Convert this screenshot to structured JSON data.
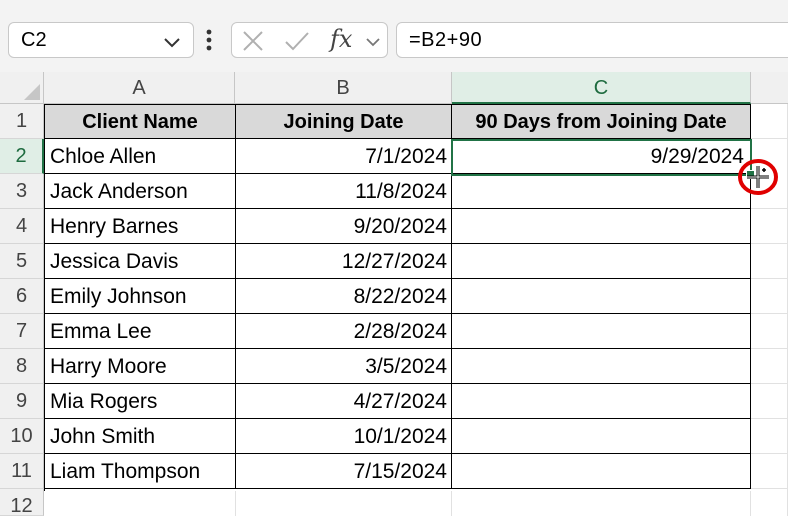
{
  "formula_bar": {
    "name_box": "C2",
    "fx_label": "fx",
    "formula": "=B2+90"
  },
  "columns": [
    "A",
    "B",
    "C"
  ],
  "rows": [
    "1",
    "2",
    "3",
    "4",
    "5",
    "6",
    "7",
    "8",
    "9",
    "10",
    "11",
    "12"
  ],
  "table": {
    "headers": [
      "Client Name",
      "Joining Date",
      "90 Days from Joining Date"
    ],
    "rows": [
      {
        "name": "Chloe Allen",
        "date": "7/1/2024",
        "result": "9/29/2024"
      },
      {
        "name": "Jack Anderson",
        "date": "11/8/2024",
        "result": ""
      },
      {
        "name": "Henry Barnes",
        "date": "9/20/2024",
        "result": ""
      },
      {
        "name": "Jessica Davis",
        "date": "12/27/2024",
        "result": ""
      },
      {
        "name": "Emily Johnson",
        "date": "8/22/2024",
        "result": ""
      },
      {
        "name": "Emma Lee",
        "date": "2/28/2024",
        "result": ""
      },
      {
        "name": "Harry Moore",
        "date": "3/5/2024",
        "result": ""
      },
      {
        "name": "Mia Rogers",
        "date": "4/27/2024",
        "result": ""
      },
      {
        "name": "John Smith",
        "date": "10/1/2024",
        "result": ""
      },
      {
        "name": "Liam Thompson",
        "date": "7/15/2024",
        "result": ""
      }
    ]
  },
  "active_cell": "C2",
  "colors": {
    "accent": "#217346",
    "header_fill": "#d9d9d9",
    "marker": "#e00000"
  },
  "icons": [
    "chevron-down-icon",
    "more-options-icon",
    "cancel-icon",
    "enter-icon",
    "insert-function-icon",
    "fill-handle-cursor-icon"
  ]
}
